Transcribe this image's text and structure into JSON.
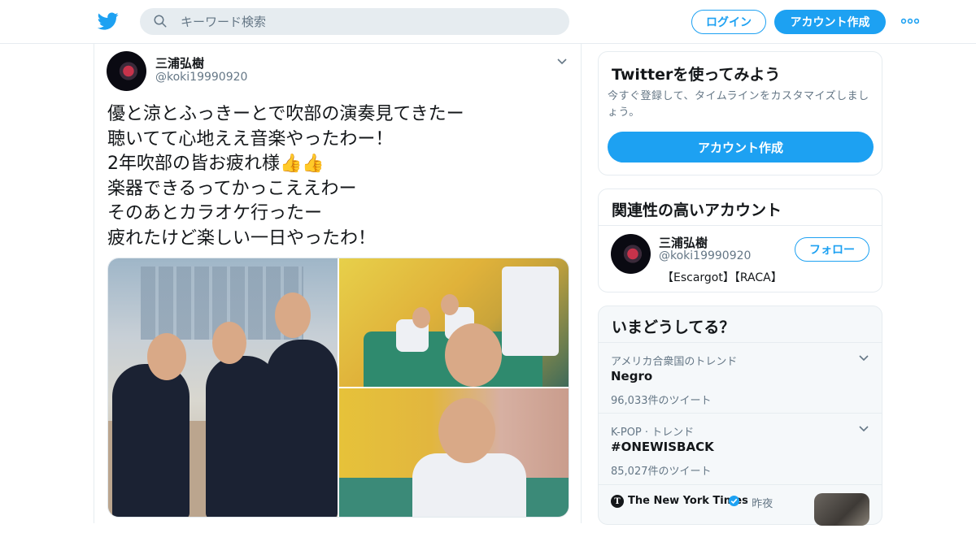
{
  "header": {
    "search_placeholder": "キーワード検索",
    "login_label": "ログイン",
    "signup_label": "アカウント作成",
    "brand_color": "#1da1f2"
  },
  "tweet": {
    "author_name": "三浦弘樹",
    "author_handle": "@koki19990920",
    "text": "優と涼とふっきーとで吹部の演奏見てきたー\n聴いてて心地ええ音楽やったわー！\n2年吹部の皆お疲れ様👍👍\n楽器できるってかっこええわー\nそのあとカラオケ行ったー\n疲れたけど楽しい一日やったわ！"
  },
  "sidebar": {
    "signup_card": {
      "title": "Twitterを使ってみよう",
      "description": "今すぐ登録して、タイムラインをカスタマイズしましょう。",
      "button_label": "アカウント作成"
    },
    "related": {
      "title": "関連性の高いアカウント",
      "account": {
        "name": "三浦弘樹",
        "handle": "@koki19990920",
        "bio": "【Escargot】【RACA】",
        "follow_label": "フォロー"
      }
    },
    "trends": {
      "title": "いまどうしてる？",
      "items": [
        {
          "meta": "アメリカ合衆国のトレンド",
          "name": "Negro",
          "count": "96,033件のツイート"
        },
        {
          "meta": "K-POP · トレンド",
          "name": "#ONEWISBACK",
          "count": "85,027件のツイート"
        }
      ],
      "news": {
        "source": "The New York Times",
        "time": "· 昨夜"
      }
    }
  }
}
